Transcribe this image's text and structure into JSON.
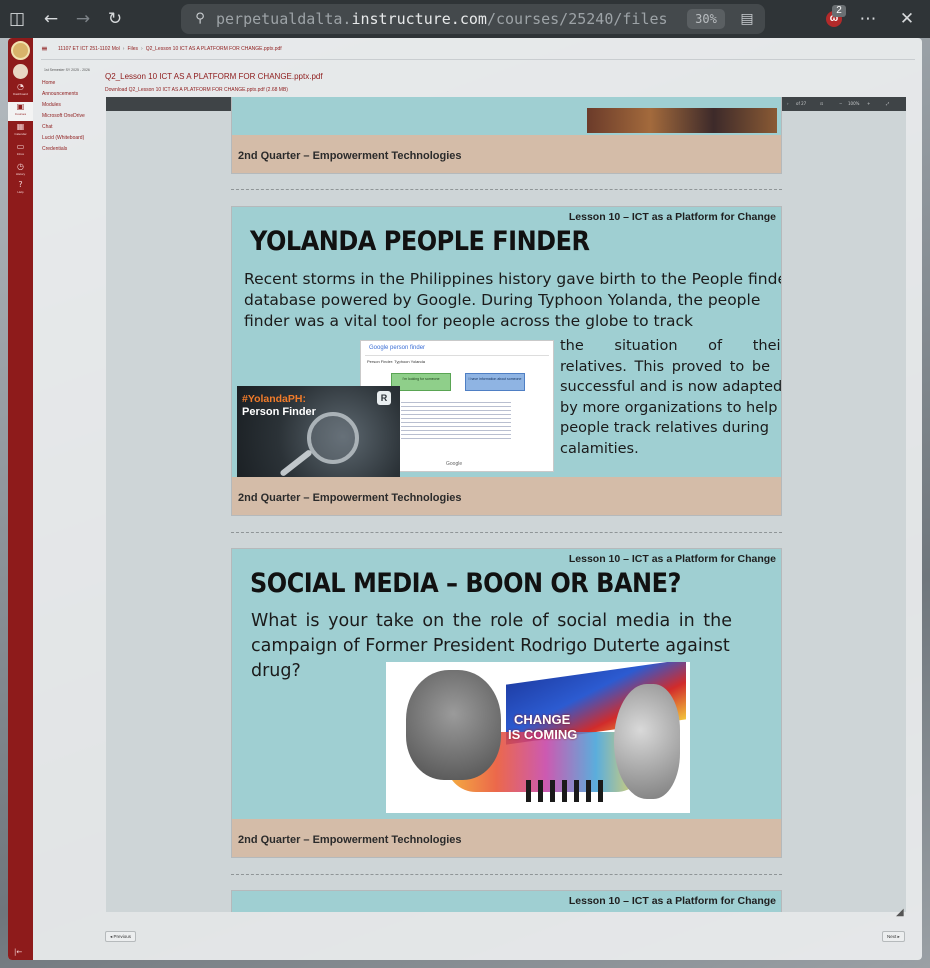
{
  "browser": {
    "url_host": "perpetualdalta.",
    "url_domain": "instructure.com",
    "url_path": "/courses/25240/files",
    "zoom": "30%",
    "extension_badge": "2",
    "extension_letter": "ω"
  },
  "breadcrumb": {
    "items": [
      "11107 ET ICT 251-1102 Mol",
      "Files",
      "Q2_Lesson 10 ICT AS A PLATFORM FOR CHANGE.pptx.pdf"
    ]
  },
  "global_nav": {
    "items": [
      {
        "label": "Account",
        "icon": "user-icon"
      },
      {
        "label": "Dashboard",
        "icon": "dashboard-icon"
      },
      {
        "label": "Courses",
        "icon": "courses-icon"
      },
      {
        "label": "Calendar",
        "icon": "calendar-icon"
      },
      {
        "label": "Inbox",
        "icon": "inbox-icon"
      },
      {
        "label": "History",
        "icon": "history-icon"
      },
      {
        "label": "Help",
        "icon": "help-icon"
      }
    ]
  },
  "course_nav": {
    "term": "1st Semester SY 2025 - 2026",
    "items": [
      "Home",
      "Announcements",
      "Modules",
      "Microsoft OneDrive",
      "Chat",
      "Lucid (Whiteboard)",
      "Credentials"
    ]
  },
  "file": {
    "title": "Q2_Lesson 10 ICT AS A PLATFORM FOR CHANGE.pptx.pdf",
    "download": "Download Q2_Lesson 10 ICT AS A PLATFORM FOR CHANGE.pptx.pdf (2.68 MB)"
  },
  "viewer": {
    "page_label": "Page",
    "page_value": "16",
    "page_total": "of 27",
    "zoom_value": "100%"
  },
  "slides": {
    "footer": "2nd Quarter – Empowerment Technologies",
    "lesson": "Lesson 10 – ICT as a Platform for Change",
    "yolanda": {
      "heading": "YOLANDA PEOPLE FINDER",
      "lines_full": [
        "Recent storms in the Philippines history gave birth to the People finder",
        "database powered by Google. During Typhoon Yolanda, the people",
        "finder was a vital tool for people across the globe to track"
      ],
      "lines_side": [
        "the situation of their",
        "relatives. This proved to be",
        "successful and is now adapted",
        "by more organizations to help",
        "people track relatives during",
        "calamities."
      ],
      "badge_tag": "#YolandaPH:",
      "badge_title": "Person Finder",
      "google_logo": "Google person finder",
      "google_field": "Person Finder: Typhoon Yolanda",
      "google_btn1": "I'm looking for someone",
      "google_btn2": "I have information about someone",
      "google_footer": "Google"
    },
    "social": {
      "heading": "SOCIAL MEDIA – BOON OR BANE?",
      "lines": [
        "What is your take on the role of social media in the",
        "campaign of Former President Rodrigo Duterte against",
        "drug?"
      ],
      "poster_line1": "CHANGE",
      "poster_line2": "IS COMING"
    }
  },
  "pager": {
    "previous": "◂ Previous",
    "next": "Next ▸"
  }
}
